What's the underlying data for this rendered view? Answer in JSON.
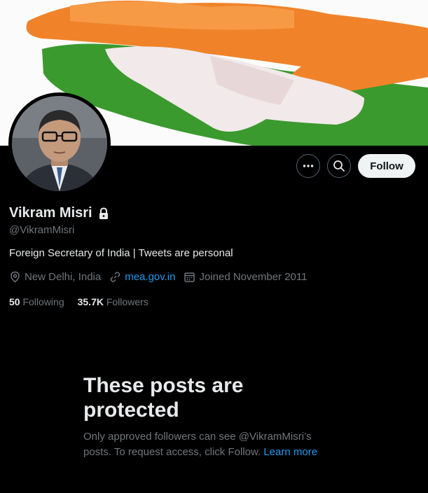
{
  "profile": {
    "name": "Vikram Misri",
    "handle": "@VikramMisri",
    "bio": "Foreign Secretary of India | Tweets are personal",
    "location": "New Delhi, India",
    "website": "mea.gov.in",
    "joined": "Joined November 2011",
    "following_count": "50",
    "following_label": "Following",
    "followers_count": "35.7K",
    "followers_label": "Followers"
  },
  "actions": {
    "follow_label": "Follow",
    "more_icon": "more-icon",
    "search_icon": "search-icon"
  },
  "protected": {
    "title": "These posts are protected",
    "description": "Only approved followers can see @VikramMisri’s posts. To request access, click Follow.",
    "learn_more": "Learn more"
  },
  "colors": {
    "background": "#000000",
    "text_primary": "#e7e9ea",
    "text_secondary": "#71767b",
    "accent": "#1d9bf0",
    "follow_button_bg": "#eff3f4"
  }
}
